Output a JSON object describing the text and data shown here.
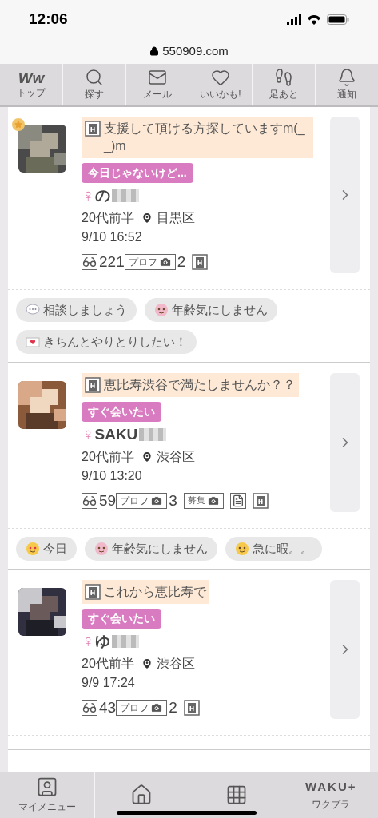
{
  "status_bar": {
    "time": "12:06"
  },
  "address_bar": {
    "url": "550909.com"
  },
  "top_nav": [
    {
      "kind": "logo",
      "logo_text": "Ww",
      "label": "トップ"
    },
    {
      "kind": "search",
      "label": "探す"
    },
    {
      "kind": "mail",
      "label": "メール"
    },
    {
      "kind": "heart",
      "label": "いいかも!"
    },
    {
      "kind": "footprints",
      "label": "足あと"
    },
    {
      "kind": "bell",
      "label": "通知"
    }
  ],
  "posts": [
    {
      "featured": true,
      "title": "支援して頂ける方探していますm(_ _)m",
      "tag": "今日じゃないけど...",
      "gender_symbol": "♀",
      "name": "の",
      "age": "20代前半",
      "area": "目黒区",
      "time": "9/10 16:52",
      "badges": [
        {
          "kind": "views",
          "value": "221"
        },
        {
          "kind": "profile_photos",
          "label": "プロフ",
          "value": "2"
        },
        {
          "kind": "h"
        }
      ],
      "chips": [
        {
          "kind": "speech",
          "text": "相談しましょう"
        },
        {
          "kind": "baby",
          "text": "年齢気にしません"
        },
        {
          "kind": "letter",
          "text": "きちんとやりとりしたい！"
        }
      ]
    },
    {
      "featured": false,
      "title": "恵比寿渋谷で満たしませんか？？",
      "tag": "すぐ会いたい",
      "gender_symbol": "♀",
      "name": "SAKU",
      "age": "20代前半",
      "area": "渋谷区",
      "time": "9/10 13:20",
      "badges": [
        {
          "kind": "views",
          "value": "59"
        },
        {
          "kind": "profile_photos",
          "label": "プロフ",
          "value": "3"
        },
        {
          "kind": "recruit_photo",
          "label": "募集"
        },
        {
          "kind": "diary"
        },
        {
          "kind": "h"
        }
      ],
      "chips": [
        {
          "kind": "hearteyes",
          "text": "今日"
        },
        {
          "kind": "baby",
          "text": "年齢気にしません"
        },
        {
          "kind": "weary",
          "text": "急に暇。。"
        }
      ]
    },
    {
      "featured": false,
      "title": "これから恵比寿で",
      "tag": "すぐ会いたい",
      "gender_symbol": "♀",
      "name": "ゆ",
      "age": "20代前半",
      "area": "渋谷区",
      "time": "9/9 17:24",
      "badges": [
        {
          "kind": "views",
          "value": "43"
        },
        {
          "kind": "profile_photos",
          "label": "プロフ",
          "value": "2"
        },
        {
          "kind": "h"
        }
      ]
    }
  ],
  "bottom_nav": [
    {
      "kind": "person",
      "label": "マイメニュー"
    },
    {
      "kind": "home"
    },
    {
      "kind": "grid"
    },
    {
      "kind": "brand",
      "logo_text": "WAKU+",
      "label": "ワクプラ"
    }
  ]
}
